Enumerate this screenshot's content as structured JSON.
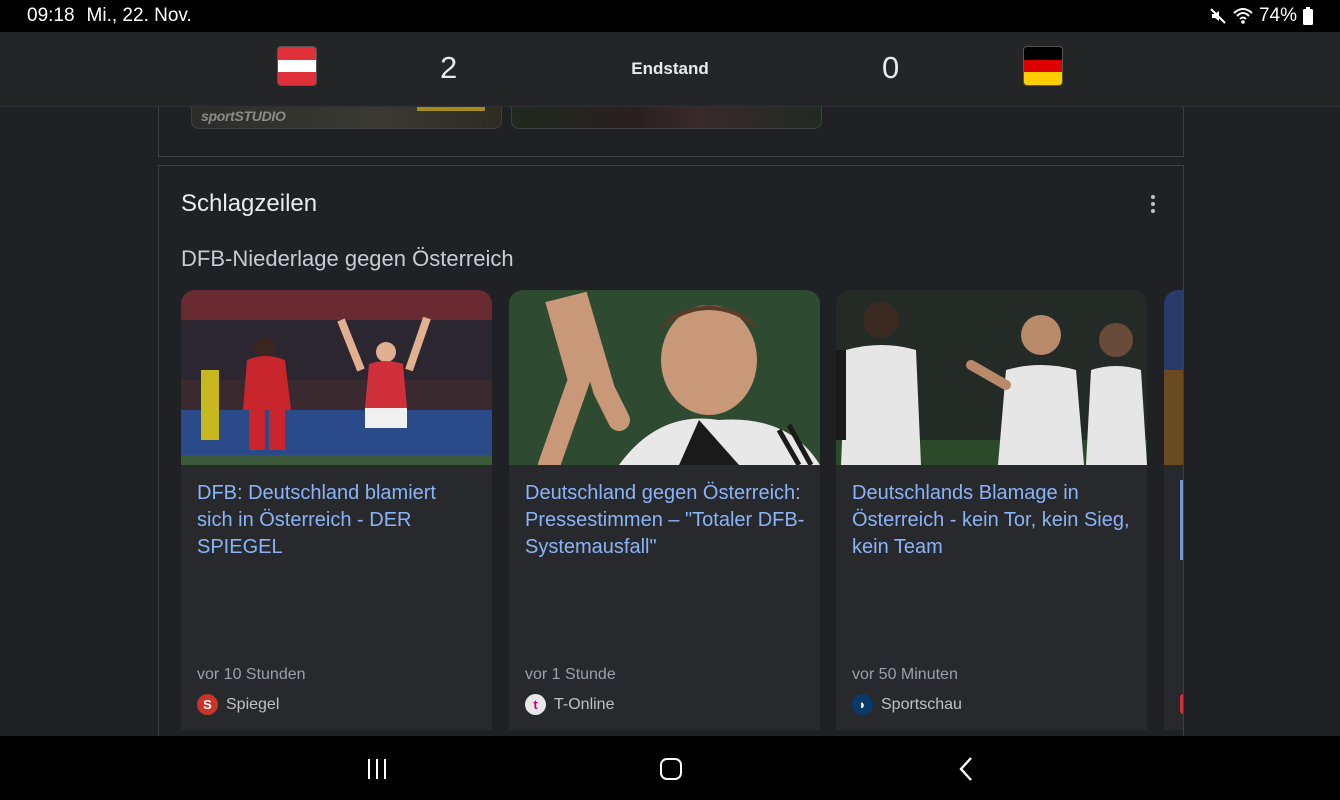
{
  "status_bar": {
    "time": "09:18",
    "date": "Mi., 22. Nov.",
    "battery": "74%",
    "icons": [
      "mute-icon",
      "wifi-icon",
      "battery-icon"
    ]
  },
  "match": {
    "home_score": "2",
    "away_score": "0",
    "status": "Endstand",
    "home_flag": "austria-flag",
    "away_flag": "germany-flag"
  },
  "prev_card": {
    "thumb1_label": "sportSTUDIO"
  },
  "headlines": {
    "title": "Schlagzeilen",
    "subtitle": "DFB-Niederlage gegen Österreich",
    "articles": [
      {
        "title": "DFB: Deutschland blamiert sich in Österreich - DER SPIEGEL",
        "time": "vor 10 Stunden",
        "source": "Spiegel"
      },
      {
        "title": "Deutschland gegen Österreich: Pressestimmen – \"Totaler DFB-Systemausfall\"",
        "time": "vor 1 Stunde",
        "source": "T-Online"
      },
      {
        "title": "Deutschlands Blamage in Österreich - kein Tor, kein Sieg, kein Team",
        "time": "vor 50 Minuten",
        "source": "Sportschau"
      }
    ]
  },
  "colors": {
    "link": "#8ab4f8",
    "background": "#202124",
    "card": "#28292c"
  }
}
